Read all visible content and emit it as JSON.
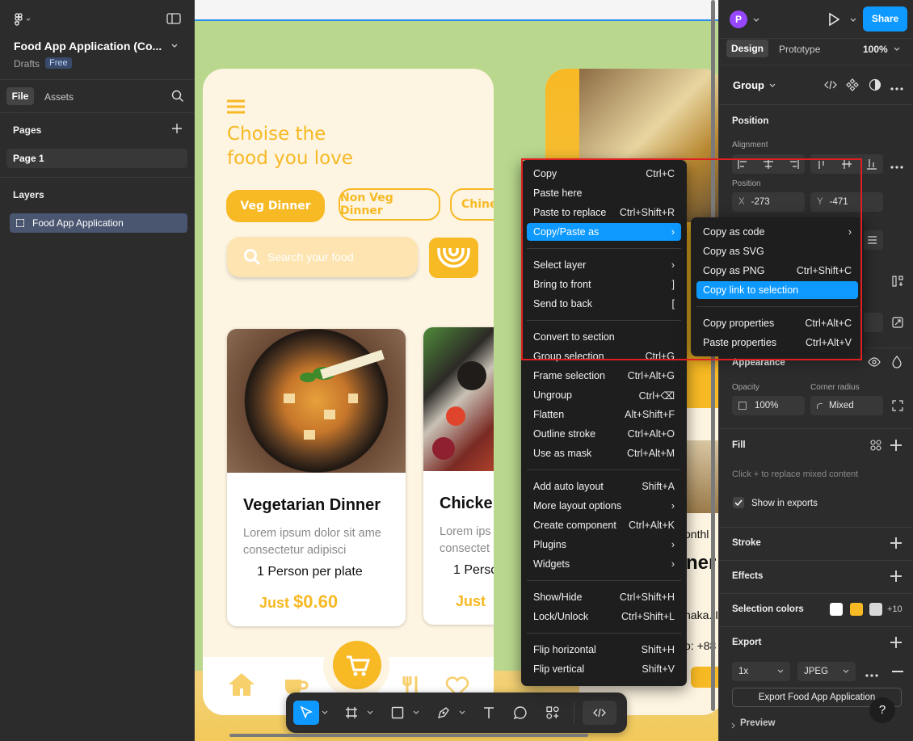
{
  "left_panel": {
    "file_title": "Food App Application (Co...",
    "drafts": "Drafts",
    "plan_badge": "Free",
    "tabs": [
      "File",
      "Assets"
    ],
    "pages_label": "Pages",
    "page_item": "Page 1",
    "layers_label": "Layers",
    "layer_item": "Food App Application"
  },
  "right_panel": {
    "avatar_letter": "P",
    "share_label": "Share",
    "tabs": [
      "Design",
      "Prototype"
    ],
    "zoom": "100%",
    "group_label": "Group",
    "position_label": "Position",
    "alignment_label": "Alignment",
    "position_sub_label": "Position",
    "x_label": "X",
    "x_value": "-273",
    "y_label": "Y",
    "y_value": "-471",
    "appearance_label": "Appearance",
    "opacity_label": "Opacity",
    "opacity_value": "100%",
    "corner_radius_label": "Corner radius",
    "corner_radius_value": "Mixed",
    "fill_label": "Fill",
    "fill_hint": "Click + to replace mixed content",
    "show_in_exports": "Show in exports",
    "stroke_label": "Stroke",
    "effects_label": "Effects",
    "selection_colors_label": "Selection colors",
    "selection_colors_more": "+10",
    "selection_colors": [
      "#ffffff",
      "#f7b924",
      "#d9d9d9"
    ],
    "export_label": "Export",
    "export_scale": "1x",
    "export_format": "JPEG",
    "export_button": "Export Food App Application",
    "preview_label": "Preview",
    "help": "?"
  },
  "design": {
    "heading_line1": "Choise the",
    "heading_line2": "food you love",
    "chips": [
      "Veg Dinner",
      "Non Veg Dinner",
      "Chine"
    ],
    "search_placeholder": "Search your food",
    "card1": {
      "title": "Vegetarian Dinner",
      "desc_line1": "Lorem ipsum dolor sit ame",
      "desc_line2": "consectetur adipisci",
      "serving": "1 Person per plate",
      "price_prefix": "Just ",
      "price": "$0.60"
    },
    "card2": {
      "title": "Chicke",
      "desc_line1": "Lorem ips",
      "desc_line2": "consectet",
      "serving": "1 Perso",
      "price_prefix": "Just"
    },
    "right_frame_texts": [
      "onthl",
      "ner",
      "haka. I",
      "o: +88"
    ],
    "accent": "#f7b924"
  },
  "context_menu": {
    "items": [
      {
        "label": "Copy",
        "shortcut": "Ctrl+C"
      },
      {
        "label": "Paste here",
        "shortcut": ""
      },
      {
        "label": "Paste to replace",
        "shortcut": "Ctrl+Shift+R"
      },
      {
        "label": "Copy/Paste as",
        "shortcut": "›"
      },
      {
        "label": "Select layer",
        "shortcut": "›"
      },
      {
        "label": "Bring to front",
        "shortcut": "]"
      },
      {
        "label": "Send to back",
        "shortcut": "["
      },
      {
        "label": "Convert to section",
        "shortcut": ""
      },
      {
        "label": "Group selection",
        "shortcut": "Ctrl+G"
      },
      {
        "label": "Frame selection",
        "shortcut": "Ctrl+Alt+G"
      },
      {
        "label": "Ungroup",
        "shortcut": "Ctrl+⌫"
      },
      {
        "label": "Flatten",
        "shortcut": "Alt+Shift+F"
      },
      {
        "label": "Outline stroke",
        "shortcut": "Ctrl+Alt+O"
      },
      {
        "label": "Use as mask",
        "shortcut": "Ctrl+Alt+M"
      },
      {
        "label": "Add auto layout",
        "shortcut": "Shift+A"
      },
      {
        "label": "More layout options",
        "shortcut": "›"
      },
      {
        "label": "Create component",
        "shortcut": "Ctrl+Alt+K"
      },
      {
        "label": "Plugins",
        "shortcut": "›"
      },
      {
        "label": "Widgets",
        "shortcut": "›"
      },
      {
        "label": "Show/Hide",
        "shortcut": "Ctrl+Shift+H"
      },
      {
        "label": "Lock/Unlock",
        "shortcut": "Ctrl+Shift+L"
      },
      {
        "label": "Flip horizontal",
        "shortcut": "Shift+H"
      },
      {
        "label": "Flip vertical",
        "shortcut": "Shift+V"
      }
    ]
  },
  "submenu": {
    "items": [
      {
        "label": "Copy as code",
        "shortcut": "›"
      },
      {
        "label": "Copy as SVG",
        "shortcut": ""
      },
      {
        "label": "Copy as PNG",
        "shortcut": "Ctrl+Shift+C"
      },
      {
        "label": "Copy link to selection",
        "shortcut": ""
      },
      {
        "label": "Copy properties",
        "shortcut": "Ctrl+Alt+C"
      },
      {
        "label": "Paste properties",
        "shortcut": "Ctrl+Alt+V"
      }
    ]
  },
  "colors": {
    "highlight": "#0d99ff",
    "annotation_box": "#e02020",
    "canvas_bg": "#b9d88e"
  }
}
